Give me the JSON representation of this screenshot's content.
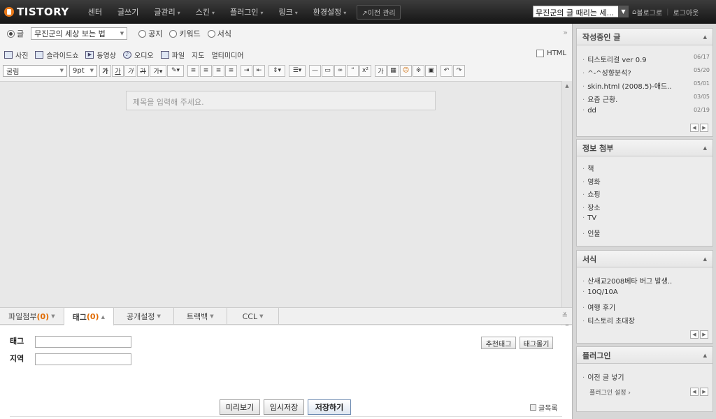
{
  "topbar": {
    "logo": "TISTORY",
    "nav": [
      {
        "label": "센터",
        "dropdown": false
      },
      {
        "label": "글쓰기",
        "dropdown": false
      },
      {
        "label": "글관리",
        "dropdown": true
      },
      {
        "label": "스킨",
        "dropdown": true
      },
      {
        "label": "플러그인",
        "dropdown": true
      },
      {
        "label": "링크",
        "dropdown": true
      },
      {
        "label": "환경설정",
        "dropdown": true
      }
    ],
    "prev_manage": "이전 관리",
    "blog_select": "무진군의 글 때리는 세...",
    "to_blog": "블로그로",
    "logout": "로그아웃"
  },
  "editor": {
    "type_options": {
      "post": "글",
      "category": "무진군의 세상 보는 법",
      "notice": "공지",
      "keyword": "키워드",
      "form": "서식"
    },
    "media": [
      "사진",
      "슬라이드쇼",
      "동영상",
      "오디오",
      "파일",
      "지도",
      "멀티미디어"
    ],
    "html_label": "HTML",
    "font": "굴림",
    "size": "9pt",
    "title_placeholder": "제목을 입력해 주세요.",
    "tabs": [
      {
        "label": "파일첨부",
        "count": "(0)",
        "active": false
      },
      {
        "label": "태그",
        "count": "(0)",
        "active": true
      },
      {
        "label": "공개설정",
        "count": "",
        "active": false
      },
      {
        "label": "트랙백",
        "count": "",
        "active": false
      },
      {
        "label": "CCL",
        "count": "",
        "active": false
      }
    ],
    "tag_label": "태그",
    "region_label": "지역",
    "recommend_tag": "추천태그",
    "tag_browse": "태그몰기",
    "preview": "미리보기",
    "temp_save": "임시저장",
    "save": "저장하기",
    "post_list": "글목록"
  },
  "sidebar": {
    "drafts": {
      "title": "작성중인 글",
      "items": [
        {
          "title": "티스토리걸 ver 0.9",
          "date": "06/17"
        },
        {
          "title": "^-^성향분석?",
          "date": "05/20"
        },
        {
          "title": "skin.html (2008.5)-애드..",
          "date": "05/01"
        },
        {
          "title": "요즘 근황.",
          "date": "03/05"
        },
        {
          "title": "dd",
          "date": "02/19"
        }
      ]
    },
    "info": {
      "title": "정보 첨부",
      "items": [
        "책",
        "영화",
        "쇼핑",
        "장소",
        "TV",
        "인물"
      ]
    },
    "forms": {
      "title": "서식",
      "items": [
        "산새교2008베타 버그 발생..",
        "10Q/10A",
        "여행 후기",
        "티스토리 초대장"
      ]
    },
    "plugins": {
      "title": "플러그인",
      "items": [
        "이전 글 넣기"
      ],
      "settings": "플러그인 설정 ›"
    }
  },
  "colors": {
    "accent": "#e06a00",
    "topbar": "#1f1f1f"
  }
}
